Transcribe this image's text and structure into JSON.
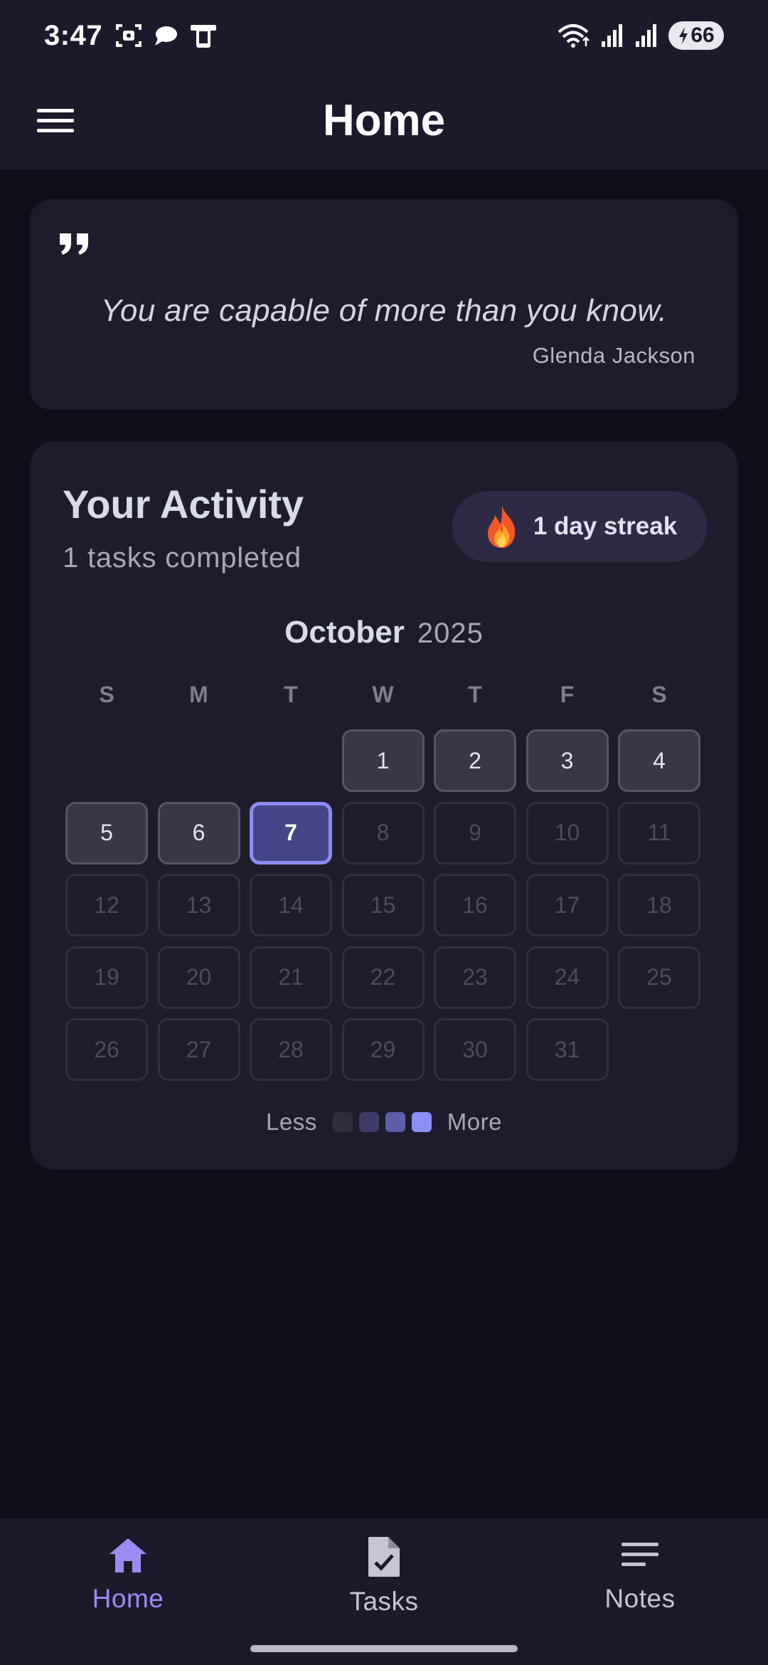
{
  "status_bar": {
    "time": "3:47",
    "battery": "66",
    "icons": [
      "screenshot-icon",
      "chat-bubble-icon",
      "device-icon",
      "wifi-icon",
      "signal-icon",
      "signal-icon",
      "battery-charging-icon"
    ]
  },
  "app_bar": {
    "title": "Home",
    "menu_icon": "hamburger-menu-icon"
  },
  "quote": {
    "text": "You are capable of more than you know.",
    "author": "Glenda Jackson"
  },
  "activity": {
    "title": "Your Activity",
    "subtitle": "1 tasks completed",
    "streak": {
      "icon": "fire-emoji",
      "label": "1 day streak"
    },
    "calendar": {
      "month": "October",
      "year": "2025",
      "weekdays": [
        "S",
        "M",
        "T",
        "W",
        "T",
        "F",
        "S"
      ],
      "first_weekday_index": 3,
      "today": 7,
      "days": [
        "1",
        "2",
        "3",
        "4",
        "5",
        "6",
        "7",
        "8",
        "9",
        "10",
        "11",
        "12",
        "13",
        "14",
        "15",
        "16",
        "17",
        "18",
        "19",
        "20",
        "21",
        "22",
        "23",
        "24",
        "25",
        "26",
        "27",
        "28",
        "29",
        "30",
        "31"
      ]
    },
    "legend": {
      "less_label": "Less",
      "more_label": "More",
      "colors": [
        "#2e2c3e",
        "#3d3c6a",
        "#5d5ea8",
        "#8c8ff8"
      ]
    }
  },
  "bottom_nav": {
    "items": [
      {
        "label": "Home",
        "icon": "home-icon",
        "selected": true
      },
      {
        "label": "Tasks",
        "icon": "task-document-icon",
        "selected": false
      },
      {
        "label": "Notes",
        "icon": "notes-lines-icon",
        "selected": false
      }
    ]
  },
  "colors": {
    "accent": "#9b8cf2",
    "today_border": "#8d8cf5",
    "background": "#100e1a",
    "surface": "#1e1c2c"
  }
}
